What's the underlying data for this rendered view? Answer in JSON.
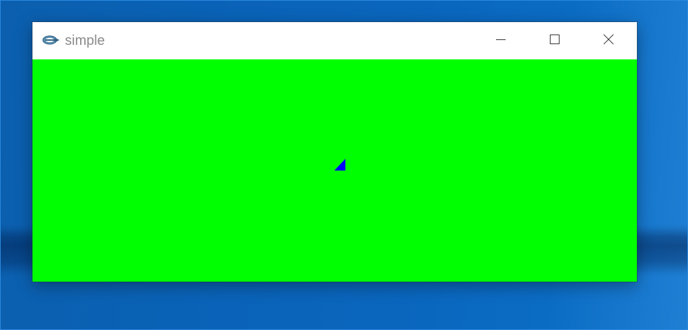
{
  "window": {
    "title": "simple",
    "app_icon": "app-logo-icon",
    "controls": {
      "minimize_icon": "minimize-icon",
      "maximize_icon": "maximize-icon",
      "close_icon": "close-icon"
    }
  },
  "canvas": {
    "background_color": "#00ff00",
    "shape": "triangle",
    "shape_color": "#0000ff"
  },
  "desktop": {
    "background_color": "#0a63b8"
  }
}
